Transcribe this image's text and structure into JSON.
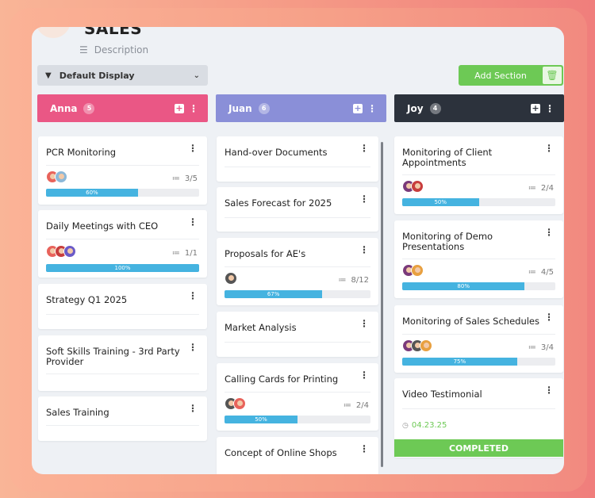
{
  "page": {
    "title": "SALES",
    "description_label": "Description",
    "filter_label": "Default Display",
    "add_section_label": "Add Section"
  },
  "colors": {
    "anna": "#ea5785",
    "juan": "#8a8fd8",
    "joy": "#2c323c",
    "progress": "#45b3e0",
    "green": "#6dc955"
  },
  "columns": [
    {
      "name": "Anna",
      "count": "5",
      "cards": [
        {
          "title": "PCR Monitoring",
          "subtasks": "3/5",
          "progress": 0.6,
          "progress_label": "60%"
        },
        {
          "title": "Daily Meetings with CEO",
          "subtasks": "1/1",
          "progress": 1.0,
          "progress_label": "100%"
        },
        {
          "title": "Strategy Q1 2025"
        },
        {
          "title": "Soft Skills Training - 3rd Party Provider"
        },
        {
          "title": "Sales Training"
        }
      ]
    },
    {
      "name": "Juan",
      "count": "6",
      "cards": [
        {
          "title": "Hand-over Documents"
        },
        {
          "title": "Sales Forecast for 2025"
        },
        {
          "title": "Proposals for AE's",
          "subtasks": "8/12",
          "progress": 0.67,
          "progress_label": "67%"
        },
        {
          "title": "Market Analysis"
        },
        {
          "title": "Calling Cards for Printing",
          "subtasks": "2/4",
          "progress": 0.5,
          "progress_label": "50%"
        },
        {
          "title": "Concept of Online Shops"
        }
      ]
    },
    {
      "name": "Joy",
      "count": "4",
      "cards": [
        {
          "title": "Monitoring of Client Appointments",
          "subtasks": "2/4",
          "progress": 0.5,
          "progress_label": "50%"
        },
        {
          "title": "Monitoring of Demo Presentations",
          "subtasks": "4/5",
          "progress": 0.8,
          "progress_label": "80%"
        },
        {
          "title": "Monitoring of Sales Schedules",
          "subtasks": "3/4",
          "progress": 0.75,
          "progress_label": "75%"
        },
        {
          "title": "Video Testimonial",
          "date": "04.23.25",
          "status": "COMPLETED"
        }
      ]
    }
  ]
}
